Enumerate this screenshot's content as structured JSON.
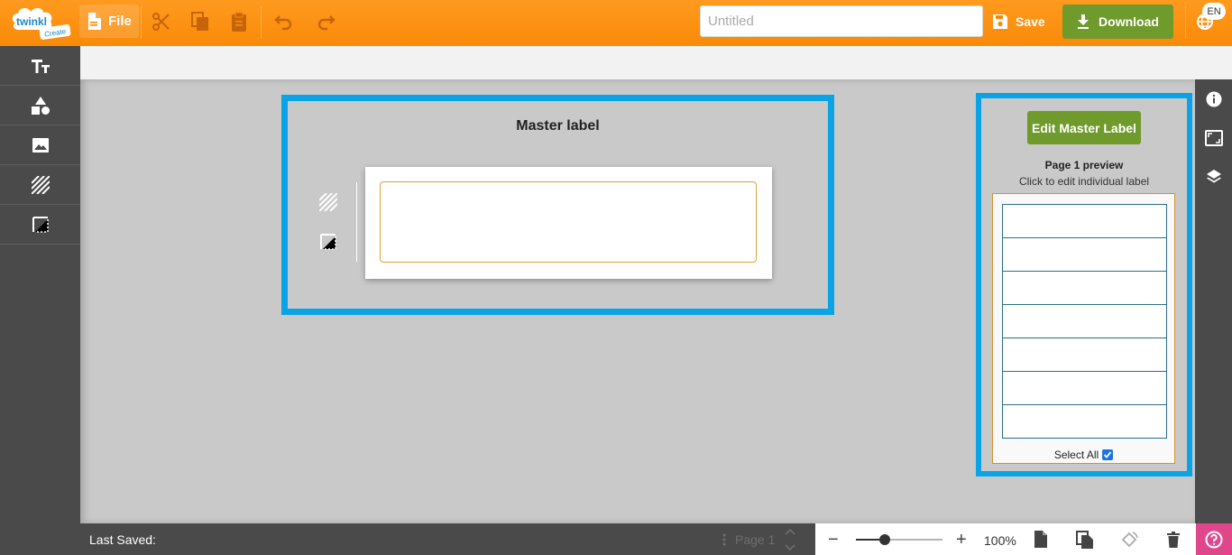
{
  "toolbar": {
    "logo_text": "twinkl",
    "logo_sub": "Create",
    "file_label": "File",
    "title_placeholder": "Untitled",
    "title_value": "",
    "save_label": "Save",
    "download_label": "Download",
    "language": "EN"
  },
  "colors": {
    "toolbar_orange": "#f98a08",
    "accent_green": "#6f9a2c",
    "highlight_blue": "#0aa3e6",
    "help_pink": "#e0478b",
    "dark_panel": "#4a4a4a"
  },
  "left_tools": [
    "text-icon",
    "shapes-icon",
    "image-icon",
    "pattern-icon",
    "border-icon"
  ],
  "master": {
    "title": "Master label"
  },
  "preview": {
    "edit_button": "Edit Master Label",
    "title": "Page 1 preview",
    "subtitle": "Click to edit individual label",
    "label_count": 7,
    "select_all": "Select All",
    "select_all_checked": true
  },
  "right_tools": [
    "info-icon",
    "fit-screen-icon",
    "layers-icon"
  ],
  "footer": {
    "last_saved": "Last Saved:",
    "page_indicator": "Page 1",
    "zoom": "100%",
    "zoom_level": 0.33
  }
}
